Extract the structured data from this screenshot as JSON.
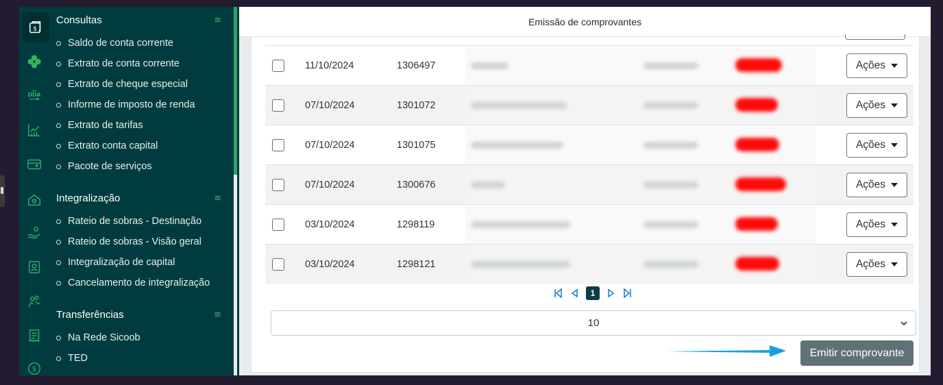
{
  "window": {
    "title": "Emissão de comprovantes"
  },
  "rail_icons": [
    "wallet-dollar-icon",
    "clover-icon",
    "dda-icon",
    "chart-icon",
    "card-icon",
    "home-shield-icon",
    "hand-coins-icon",
    "id-badge-icon",
    "people-icon",
    "receipt-icon",
    "dollar-circle-icon"
  ],
  "rail_dda_text": "DDA",
  "menu": {
    "sections": [
      {
        "title": "Consultas",
        "items": [
          "Saldo de conta corrente",
          "Extrato de conta corrente",
          "Extrato de cheque especial",
          "Informe de imposto de renda",
          "Extrato de tarifas",
          "Extrato conta capital",
          "Pacote de serviços"
        ]
      },
      {
        "title": "Integralização",
        "items": [
          "Rateio de sobras - Destinação",
          "Rateio de sobras - Visão geral",
          "Integralização de capital",
          "Cancelamento de integralização"
        ]
      },
      {
        "title": "Transferências",
        "items": [
          "Na Rede Sicoob",
          "TED"
        ]
      }
    ],
    "hamburger_glyph": "≡"
  },
  "table": {
    "rows": [
      {
        "date": "11/10/2024",
        "number": "1306497",
        "action": "Ações"
      },
      {
        "date": "07/10/2024",
        "number": "1301072",
        "action": "Ações"
      },
      {
        "date": "07/10/2024",
        "number": "1301075",
        "action": "Ações"
      },
      {
        "date": "07/10/2024",
        "number": "1300676",
        "action": "Ações"
      },
      {
        "date": "03/10/2024",
        "number": "1298119",
        "action": "Ações"
      },
      {
        "date": "03/10/2024",
        "number": "1298121",
        "action": "Ações"
      }
    ]
  },
  "pagination": {
    "current_page": "1"
  },
  "page_size": {
    "value": "10"
  },
  "emit_button": {
    "label": "Emitir comprovante"
  },
  "colors": {
    "sidebar": "#003c3f",
    "accent_green": "#2aa46c",
    "emit_button": "#5f7377",
    "pager_active": "#0f3c4a",
    "arrow": "#1aa0e0"
  }
}
